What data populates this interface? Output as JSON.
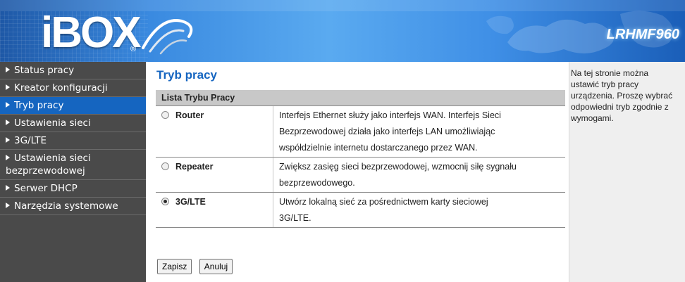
{
  "header": {
    "logo": "iBOX",
    "logo_sub": "®",
    "model": "LRHMF960"
  },
  "sidebar": {
    "items": [
      {
        "label": "Status pracy",
        "active": false
      },
      {
        "label": "Kreator konfiguracji",
        "active": false
      },
      {
        "label": "Tryb pracy",
        "active": true
      },
      {
        "label": "Ustawienia sieci",
        "active": false
      },
      {
        "label": "3G/LTE",
        "active": false
      },
      {
        "label": "Ustawienia sieci bezprzewodowej",
        "active": false
      },
      {
        "label": "Serwer DHCP",
        "active": false
      },
      {
        "label": "Narzędzia systemowe",
        "active": false
      }
    ]
  },
  "main": {
    "title": "Tryb pracy",
    "table_header": "Lista Trybu Pracy",
    "modes": [
      {
        "name": "Router",
        "selected": false,
        "lines": [
          "Interfejs Ethernet służy jako interfejs WAN. Interfejs Sieci",
          "Bezprzewodowej działa jako interfejs LAN umożliwiając",
          "współdzielnie internetu dostarczanego przez WAN."
        ]
      },
      {
        "name": "Repeater",
        "selected": false,
        "lines": [
          "Zwiększ zasięg sieci bezprzewodowej, wzmocnij siłę sygnału",
          "bezprzewodowego."
        ]
      },
      {
        "name": "3G/LTE",
        "selected": true,
        "lines": [
          "Utwórz lokalną sieć za pośrednictwem karty sieciowej",
          "3G/LTE."
        ]
      }
    ],
    "save_label": "Zapisz",
    "cancel_label": "Anuluj"
  },
  "help": {
    "lines": [
      "Na tej stronie można",
      "ustawić tryb pracy",
      "urządzenia. Proszę wybrać",
      "odpowiedni tryb zgodnie z",
      "wymogami."
    ]
  },
  "colors": {
    "accent": "#1565c0",
    "sidebar_bg": "#4a4a4a",
    "header_bg": "#3a8ae0"
  }
}
